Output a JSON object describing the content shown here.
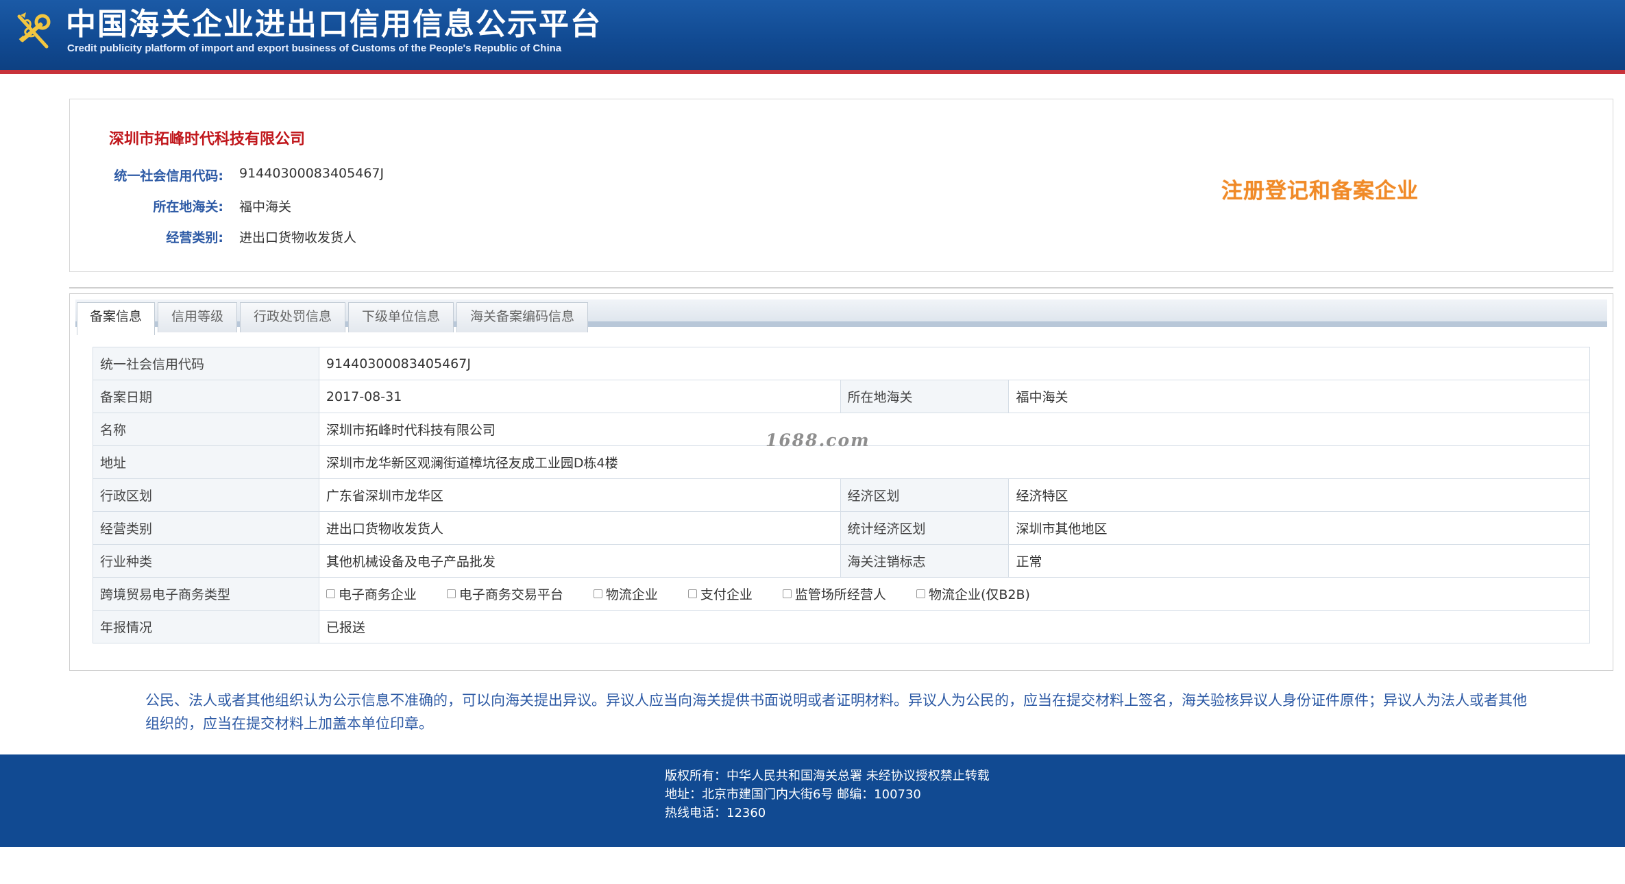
{
  "header": {
    "title": "中国海关企业进出口信用信息公示平台",
    "subtitle": "Credit publicity platform of import and export business of Customs of the People's Republic of China"
  },
  "company": {
    "name": "深圳市拓峰时代科技有限公司",
    "credit_code_label": "统一社会信用代码:",
    "credit_code": "91440300083405467J",
    "customs_label": "所在地海关:",
    "customs": "福中海关",
    "category_label": "经营类别:",
    "category": "进出口货物收发货人",
    "badge": "注册登记和备案企业"
  },
  "tabs": [
    {
      "label": "备案信息",
      "active": true
    },
    {
      "label": "信用等级",
      "active": false
    },
    {
      "label": "行政处罚信息",
      "active": false
    },
    {
      "label": "下级单位信息",
      "active": false
    },
    {
      "label": "海关备案编码信息",
      "active": false
    }
  ],
  "table": {
    "credit_code_label": "统一社会信用代码",
    "credit_code": "91440300083405467J",
    "record_date_label": "备案日期",
    "record_date": "2017-08-31",
    "customs_label": "所在地海关",
    "customs": "福中海关",
    "name_label": "名称",
    "name": "深圳市拓峰时代科技有限公司",
    "address_label": "地址",
    "address": "深圳市龙华新区观澜街道樟坑径友成工业园D栋4楼",
    "admin_region_label": "行政区划",
    "admin_region": "广东省深圳市龙华区",
    "econ_region_label": "经济区划",
    "econ_region": "经济特区",
    "biz_category_label": "经营类别",
    "biz_category": "进出口货物收发货人",
    "stat_region_label": "统计经济区划",
    "stat_region": "深圳市其他地区",
    "industry_label": "行业种类",
    "industry": "其他机械设备及电子产品批发",
    "cancel_flag_label": "海关注销标志",
    "cancel_flag": "正常",
    "ecommerce_label": "跨境贸易电子商务类型",
    "ecommerce_options": [
      {
        "label": "电子商务企业",
        "checked": false
      },
      {
        "label": "电子商务交易平台",
        "checked": false
      },
      {
        "label": "物流企业",
        "checked": false
      },
      {
        "label": "支付企业",
        "checked": false
      },
      {
        "label": "监管场所经营人",
        "checked": false
      },
      {
        "label": "物流企业(仅B2B)",
        "checked": false
      }
    ],
    "annual_report_label": "年报情况",
    "annual_report": "已报送"
  },
  "watermark": "1688.com",
  "notice": "公民、法人或者其他组织认为公示信息不准确的，可以向海关提出异议。异议人应当向海关提供书面说明或者证明材料。异议人为公民的，应当在提交材料上签名，海关验核异议人身份证件原件；异议人为法人或者其他组织的，应当在提交材料上加盖本单位印章。",
  "footer": {
    "copyright": "版权所有：中华人民共和国海关总署   未经协议授权禁止转载",
    "address": "地址：北京市建国门内大街6号 邮编：100730",
    "hotline": "热线电话：12360"
  },
  "colors": {
    "header_blue": "#114a92",
    "header_red_line": "#c8323a",
    "company_red": "#c0161b",
    "label_blue": "#2d5aa5",
    "badge_orange": "#f08a28"
  }
}
